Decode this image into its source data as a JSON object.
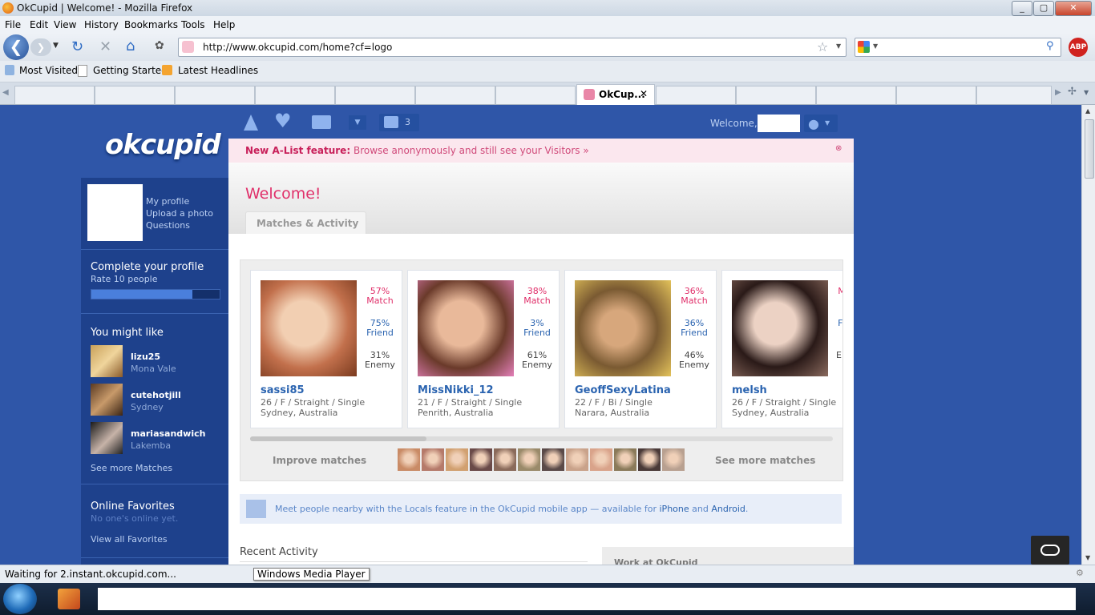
{
  "window": {
    "title": "OkCupid | Welcome! - Mozilla Firefox"
  },
  "menu": [
    "File",
    "Edit",
    "View",
    "History",
    "Bookmarks",
    "Tools",
    "Help"
  ],
  "nav": {
    "url": "http://www.okcupid.com/home?cf=logo"
  },
  "bookmarks": [
    "Most Visited",
    "Getting Started",
    "Latest Headlines"
  ],
  "tabs": {
    "active": "OkCup..."
  },
  "header": {
    "welcome": "Welcome,",
    "inbox_count": "3"
  },
  "banner": {
    "label": "New A-List feature:",
    "text": "Browse anonymously and still see your Visitors »"
  },
  "logo": "okcupid",
  "sidebar": {
    "links": [
      "My profile",
      "Upload a photo",
      "Questions"
    ],
    "complete_title": "Complete your profile",
    "complete_sub": "Rate 10 people",
    "progress": 0.79,
    "might_like_title": "You might like",
    "suggestions": [
      {
        "name": "lizu25",
        "place": "Mona Vale"
      },
      {
        "name": "cutehotjill",
        "place": "Sydney"
      },
      {
        "name": "mariasandwich",
        "place": "Lakemba"
      }
    ],
    "see_more": "See more Matches",
    "favorites_title": "Online Favorites",
    "favorites_sub": "No one's online yet.",
    "view_all": "View all Favorites"
  },
  "main": {
    "welcome": "Welcome!",
    "tab": "Matches & Activity",
    "matches": [
      {
        "name": "sassi85",
        "match": "57%",
        "friend": "75%",
        "enemy": "31%",
        "info": "26 / F / Straight / Single",
        "location": "Sydney, Australia"
      },
      {
        "name": "MissNikki_12",
        "match": "38%",
        "friend": "3%",
        "enemy": "61%",
        "info": "21 / F / Straight / Single",
        "location": "Penrith, Australia"
      },
      {
        "name": "GeoffSexyLatina",
        "match": "36%",
        "friend": "36%",
        "enemy": "46%",
        "info": "22 / F / Bi / Single",
        "location": "Narara, Australia"
      },
      {
        "name": "melsh",
        "match": "",
        "friend": "",
        "enemy": "",
        "info": "26 / F / Straight / Single",
        "location": "Sydney, Australia"
      }
    ],
    "labels": {
      "match": "Match",
      "friend": "Friend",
      "enemy": "Enemy"
    },
    "improve": "Improve matches",
    "see_more": "See more matches",
    "locals_pre": "Meet people nearby with the Locals feature in the OkCupid mobile app — available for",
    "locals_iphone": "iPhone",
    "locals_and": "and",
    "locals_android": "Android",
    "locals_dot": ".",
    "recent": "Recent Activity",
    "work": "Work at OkCupid"
  },
  "status": {
    "text": "Waiting for 2.instant.okcupid.com...",
    "tooltip": "Windows Media Player"
  },
  "colors": {
    "page_bg": "#2f56a8",
    "pink": "#e0306a",
    "link_blue": "#2b64b0"
  }
}
